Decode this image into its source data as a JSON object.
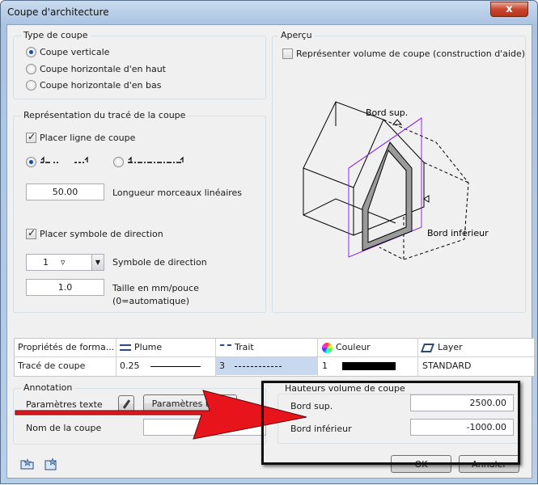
{
  "window": {
    "title": "Coupe d'architecture",
    "close_glyph": "x"
  },
  "type_coupe": {
    "legend": "Type de coupe",
    "options": [
      "Coupe verticale",
      "Coupe horizontale d'en haut",
      "Coupe horizontale d'en bas"
    ],
    "selected": 0
  },
  "representation": {
    "legend": "Représentation du tracé de la coupe",
    "placer_ligne": "Placer ligne de coupe",
    "longueur_value": "50.00",
    "longueur_label": "Longueur morceaux linéaires",
    "placer_symbole": "Placer symbole de direction",
    "symbole_value": "1",
    "symbole_label": "Symbole de direction",
    "taille_value": "1.0",
    "taille_label_1": "Taille en mm/pouce",
    "taille_label_2": "(0=automatique)"
  },
  "apercu": {
    "legend": "Aperçu",
    "checkbox_label": "Représenter volume de coupe (construction d'aide)",
    "bord_sup": "Bord sup.",
    "bord_inf": "Bord inférieur"
  },
  "format_table": {
    "headers": [
      "Propriétés de forma...",
      "Plume",
      "Trait",
      "Couleur",
      "Layer"
    ],
    "row": {
      "label": "Tracé de coupe",
      "plume": "0.25",
      "trait": "3",
      "couleur": "1",
      "layer": "STANDARD"
    }
  },
  "annotation": {
    "legend": "Annotation",
    "param_label": "Paramètres texte",
    "param_button": "Paramètres texte",
    "nom_label": "Nom de la coupe",
    "nom_value": ""
  },
  "hauteurs": {
    "legend": "Hauteurs volume de coupe",
    "bord_sup_label": "Bord sup.",
    "bord_sup_value": "2500.00",
    "bord_inf_label": "Bord inférieur",
    "bord_inf_value": "-1000.00"
  },
  "footer": {
    "ok": "OK",
    "cancel": "Annuler"
  },
  "colors": {
    "accent_red": "#e8141c",
    "purple_plane": "#8a2be2",
    "section_gray": "#9a9a9a"
  }
}
